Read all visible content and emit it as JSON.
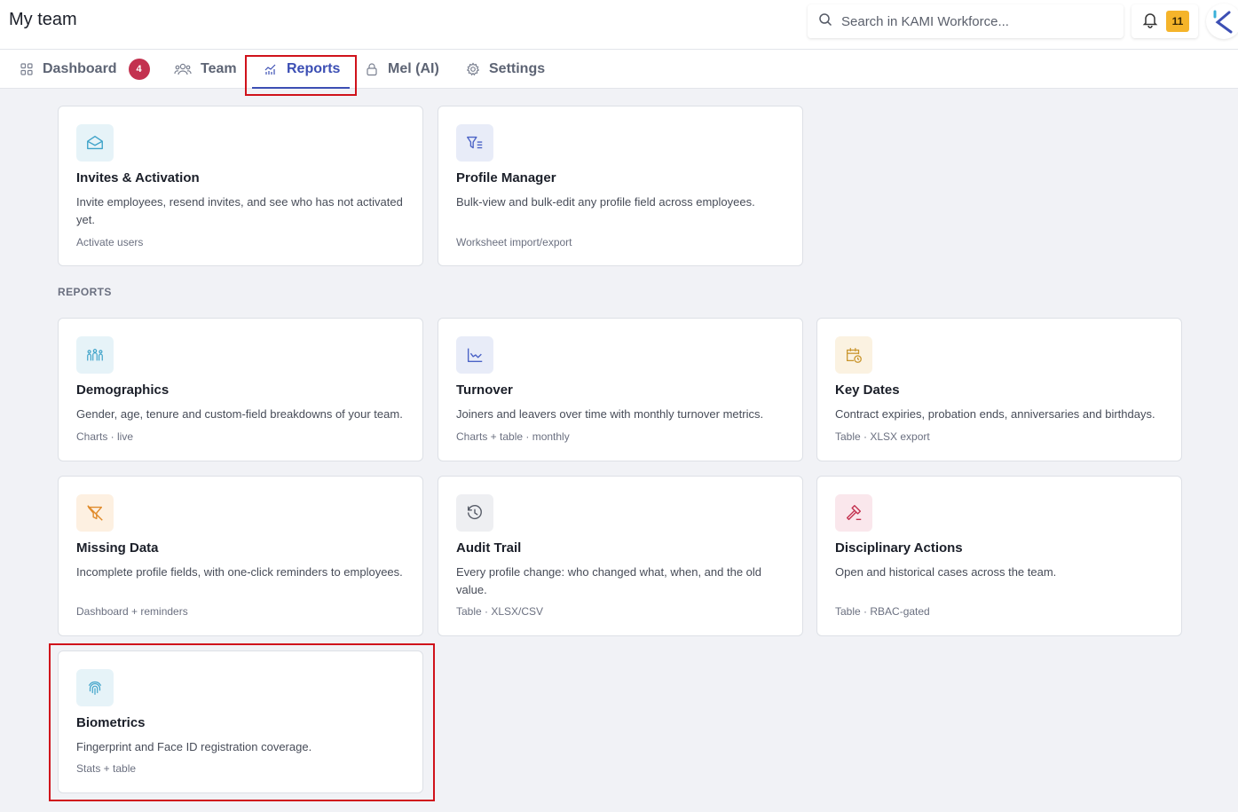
{
  "header": {
    "title": "My team",
    "search_placeholder": "Search in KAMI Workforce...",
    "notifications_count": "11"
  },
  "tabs": [
    {
      "label": "Dashboard",
      "icon": "grid-icon",
      "badge": "4",
      "active": false
    },
    {
      "label": "Team",
      "icon": "users-icon",
      "active": false
    },
    {
      "label": "Reports",
      "icon": "chart-icon",
      "active": true
    },
    {
      "label": "Mel (AI)",
      "icon": "lock-icon",
      "active": false
    },
    {
      "label": "Settings",
      "icon": "gear-icon",
      "active": false
    }
  ],
  "tools": [
    {
      "title": "Invites & Activation",
      "desc": "Invite employees, resend invites, and see who has not activated yet.",
      "meta": "Activate users",
      "icon": "envelope-icon",
      "icon_color": "#3fa3c9",
      "icon_bg": "#e6f3f8"
    },
    {
      "title": "Profile Manager",
      "desc": "Bulk-view and bulk-edit any profile field across employees.",
      "meta": "Worksheet import/export",
      "icon": "filter-list-icon",
      "icon_color": "#4b63c6",
      "icon_bg": "#e8ecf8"
    }
  ],
  "reports_section": {
    "label": "REPORTS"
  },
  "reports": [
    {
      "title": "Demographics",
      "desc": "Gender, age, tenure and custom-field breakdowns of your team.",
      "meta": "Charts · live",
      "icon": "people-group-icon",
      "icon_color": "#3fa3c9",
      "icon_bg": "#e6f3f8"
    },
    {
      "title": "Turnover",
      "desc": "Joiners and leavers over time with monthly turnover metrics.",
      "meta": "Charts + table · monthly",
      "icon": "line-chart-icon",
      "icon_color": "#4b63c6",
      "icon_bg": "#e8ecf8"
    },
    {
      "title": "Key Dates",
      "desc": "Contract expiries, probation ends, anniversaries and birthdays.",
      "meta": "Table · XLSX export",
      "icon": "calendar-clock-icon",
      "icon_color": "#c9952c",
      "icon_bg": "#fbf2e1"
    },
    {
      "title": "Missing Data",
      "desc": "Incomplete profile fields, with one-click reminders to employees.",
      "meta": "Dashboard + reminders",
      "icon": "filter-off-icon",
      "icon_color": "#e08a2a",
      "icon_bg": "#fdf0e1"
    },
    {
      "title": "Audit Trail",
      "desc": "Every profile change: who changed what, when, and the old value.",
      "meta": "Table · XLSX/CSV",
      "icon": "history-icon",
      "icon_color": "#555a66",
      "icon_bg": "#eeeff2"
    },
    {
      "title": "Disciplinary Actions",
      "desc": "Open and historical cases across the team.",
      "meta": "Table · RBAC-gated",
      "icon": "gavel-icon",
      "icon_color": "#c3314f",
      "icon_bg": "#fae7ec"
    },
    {
      "title": "Biometrics",
      "desc": "Fingerprint and Face ID registration coverage.",
      "meta": "Stats + table",
      "icon": "fingerprint-icon",
      "icon_color": "#3fa3c9",
      "icon_bg": "#e6f3f8"
    }
  ],
  "colors": {
    "accent": "#3c4fb4",
    "highlight_border": "#d0121b",
    "badge": "#c3314f",
    "notification": "#f5b42a"
  }
}
